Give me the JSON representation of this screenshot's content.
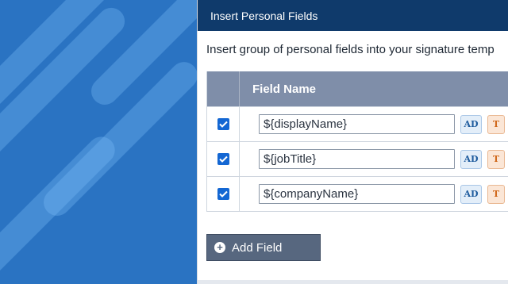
{
  "dialog": {
    "title": "Insert Personal Fields",
    "description": "Insert group of personal fields into your signature temp",
    "table": {
      "header": "Field Name",
      "rows": [
        {
          "value": "${displayName}",
          "checked": true,
          "tag_ad": "AD",
          "tag_t": "T"
        },
        {
          "value": "${jobTitle}",
          "checked": true,
          "tag_ad": "AD",
          "tag_t": "T"
        },
        {
          "value": "${companyName}",
          "checked": true,
          "tag_ad": "AD",
          "tag_t": "T"
        }
      ]
    },
    "add_button": "Add Field"
  },
  "colors": {
    "side_panel": "#2a73c2",
    "titlebar": "#0f3a6b",
    "table_header": "#7f8ea9",
    "checkbox": "#1467d3",
    "button": "#57677f"
  },
  "icons": [
    "checkmark-icon",
    "plus-circle-icon"
  ]
}
